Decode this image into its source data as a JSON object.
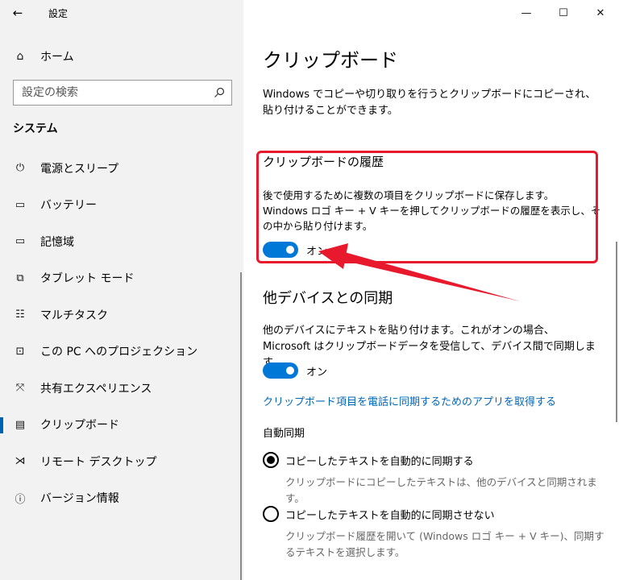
{
  "window": {
    "app_title": "設定",
    "back_glyph": "←",
    "minimize_glyph": "—",
    "maximize_glyph": "☐",
    "close_glyph": "✕"
  },
  "sidebar": {
    "home_icon": "⌂",
    "home_label": "ホーム",
    "search_placeholder": "設定の検索",
    "section_title": "システム",
    "items": [
      {
        "label": "電源とスリープ",
        "icon": "power-icon",
        "glyph": "⏻"
      },
      {
        "label": "バッテリー",
        "icon": "battery-icon",
        "glyph": "▭"
      },
      {
        "label": "記憶域",
        "icon": "storage-icon",
        "glyph": "▭"
      },
      {
        "label": "タブレット モード",
        "icon": "tablet-mode-icon",
        "glyph": "⧉"
      },
      {
        "label": "マルチタスク",
        "icon": "multitask-icon",
        "glyph": "☷"
      },
      {
        "label": "この PC へのプロジェクション",
        "icon": "projection-icon",
        "glyph": "⊡"
      },
      {
        "label": "共有エクスペリエンス",
        "icon": "shared-experience-icon",
        "glyph": "⤧"
      },
      {
        "label": "クリップボード",
        "icon": "clipboard-icon",
        "glyph": "▤"
      },
      {
        "label": "リモート デスクトップ",
        "icon": "remote-desktop-icon",
        "glyph": "⋊"
      },
      {
        "label": "バージョン情報",
        "icon": "info-icon",
        "glyph": "ⓘ"
      }
    ],
    "active_index": 7
  },
  "main": {
    "title": "クリップボード",
    "description": "Windows でコピーや切り取りを行うとクリップボードにコピーされ、貼り付けることができます。",
    "history": {
      "title": "クリップボードの履歴",
      "desc1": "後で使用するために複数の項目をクリップボードに保存します。",
      "desc2": "Windows ロゴ キー + V キーを押してクリップボードの履歴を表示し、その中から貼り付けます。",
      "toggle_label": "オン",
      "toggle_on": true
    },
    "sync": {
      "title": "他デバイスとの同期",
      "desc": "他のデバイスにテキストを貼り付けます。これがオンの場合、Microsoft はクリップボードデータを受信して、デバイス間で同期します。",
      "toggle_label": "オン",
      "toggle_on": true,
      "link": "クリップボード項目を電話に同期するためのアプリを取得する"
    },
    "auto_sync": {
      "title": "自動同期",
      "options": [
        {
          "label": "コピーしたテキストを自動的に同期する",
          "sub": "クリップボードにコピーしたテキストは、他のデバイスと同期されます。",
          "selected": true
        },
        {
          "label": "コピーしたテキストを自動的に同期させない",
          "sub": "クリップボード履歴を開いて (Windows ロゴ キー + V キー)、同期するテキストを選択します。",
          "selected": false
        }
      ]
    }
  },
  "colors": {
    "accent": "#0078d7",
    "link": "#0067b8",
    "annotation": "#e8192c"
  }
}
